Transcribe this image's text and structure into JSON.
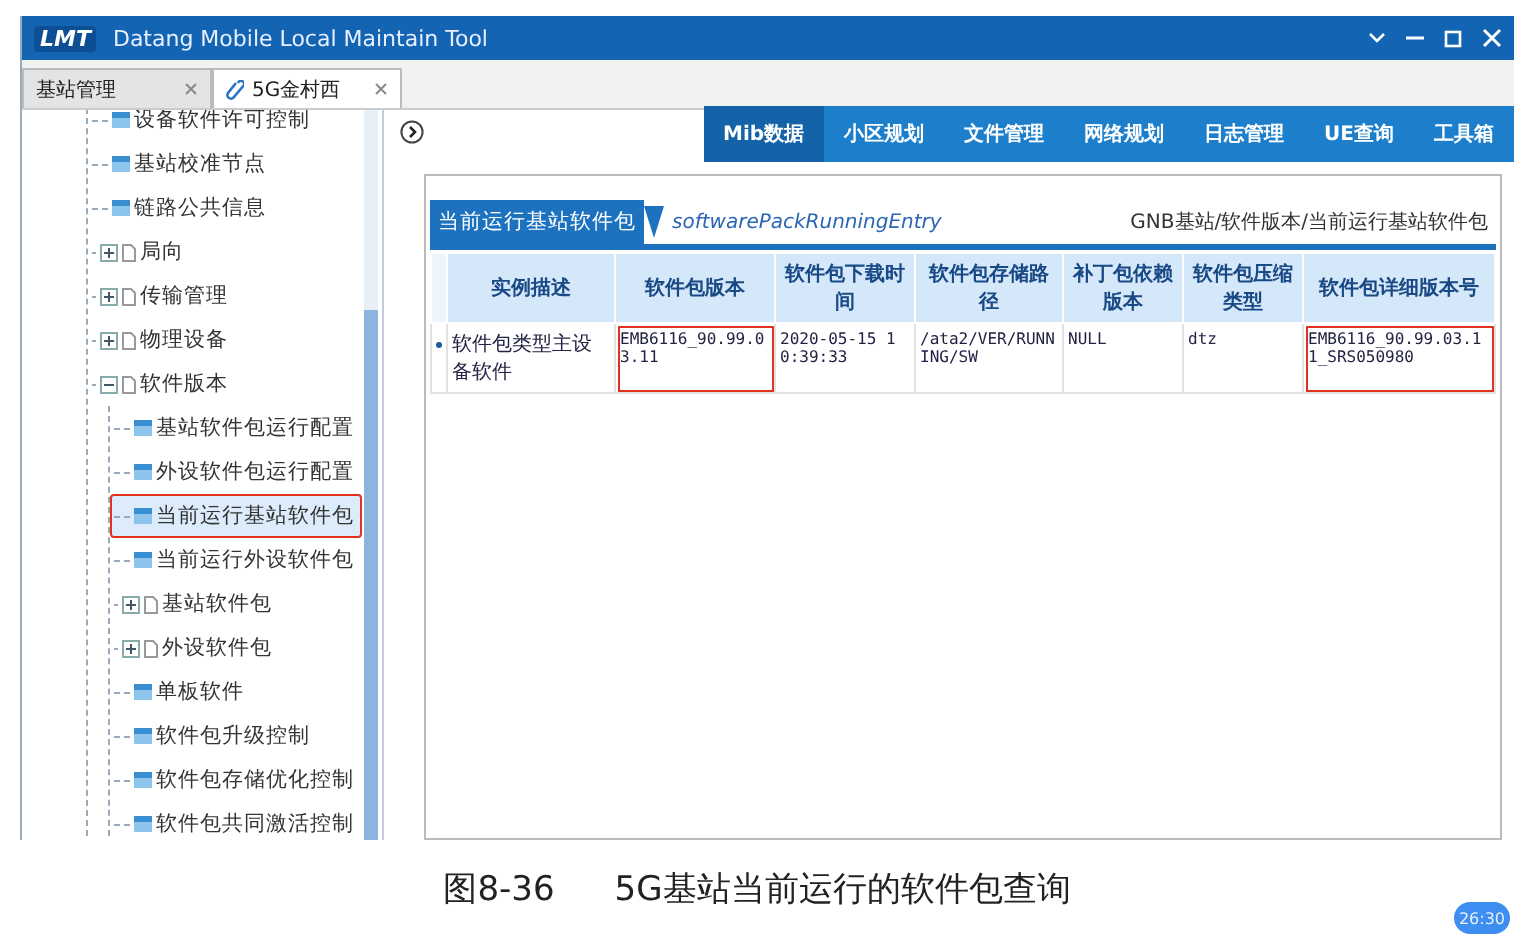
{
  "window": {
    "logo": "LMT",
    "title": "Datang Mobile Local Maintain Tool"
  },
  "doc_tabs": [
    {
      "label": "基站管理",
      "selected": false
    },
    {
      "label": "5G金村西",
      "selected": true
    }
  ],
  "tree": {
    "items": [
      {
        "label": "设备软件许可控制",
        "kind": "leaf",
        "selected": false,
        "highlighted": false
      },
      {
        "label": "基站校准节点",
        "kind": "leaf",
        "selected": false,
        "highlighted": false
      },
      {
        "label": "链路公共信息",
        "kind": "leaf",
        "selected": false,
        "highlighted": false
      },
      {
        "label": "局向",
        "kind": "folder",
        "expanded": false,
        "selected": false,
        "highlighted": false
      },
      {
        "label": "传输管理",
        "kind": "folder",
        "expanded": false,
        "selected": false,
        "highlighted": false
      },
      {
        "label": "物理设备",
        "kind": "folder",
        "expanded": false,
        "selected": false,
        "highlighted": false
      },
      {
        "label": "软件版本",
        "kind": "folder",
        "expanded": true,
        "selected": false,
        "highlighted": false,
        "children": [
          {
            "label": "基站软件包运行配置",
            "kind": "leaf",
            "selected": false,
            "highlighted": false
          },
          {
            "label": "外设软件包运行配置",
            "kind": "leaf",
            "selected": false,
            "highlighted": false
          },
          {
            "label": "当前运行基站软件包",
            "kind": "leaf",
            "selected": true,
            "highlighted": true
          },
          {
            "label": "当前运行外设软件包",
            "kind": "leaf",
            "selected": false,
            "highlighted": false
          },
          {
            "label": "基站软件包",
            "kind": "folder",
            "expanded": false,
            "selected": false,
            "highlighted": false
          },
          {
            "label": "外设软件包",
            "kind": "folder",
            "expanded": false,
            "selected": false,
            "highlighted": false
          },
          {
            "label": "单板软件",
            "kind": "leaf",
            "selected": false,
            "highlighted": false
          },
          {
            "label": "软件包升级控制",
            "kind": "leaf",
            "selected": false,
            "highlighted": false
          },
          {
            "label": "软件包存储优化控制",
            "kind": "leaf",
            "selected": false,
            "highlighted": false
          },
          {
            "label": "软件包共同激活控制",
            "kind": "leaf",
            "selected": false,
            "highlighted": false
          }
        ]
      }
    ]
  },
  "nav_tabs": [
    {
      "label": "Mib数据",
      "selected": true
    },
    {
      "label": "小区规划",
      "selected": false
    },
    {
      "label": "文件管理",
      "selected": false
    },
    {
      "label": "网络规划",
      "selected": false
    },
    {
      "label": "日志管理",
      "selected": false
    },
    {
      "label": "UE查询",
      "selected": false
    },
    {
      "label": "工具箱",
      "selected": false
    }
  ],
  "panel": {
    "title": "当前运行基站软件包",
    "entry": "softwarePackRunningEntry",
    "breadcrumb": "GNB基站/软件版本/当前运行基站软件包",
    "table": {
      "columns": [
        "实例描述",
        "软件包版本",
        "软件包下载时间",
        "软件包存储路径",
        "补丁包依赖版本",
        "软件包压缩类型",
        "软件包详细版本号"
      ],
      "rows": [
        {
          "cells": [
            {
              "text": "软件包类型主设备软件",
              "highlighted": false
            },
            {
              "text": "EMB6116_90.99.03.11",
              "highlighted": true
            },
            {
              "text": "2020-05-15 10:39:33",
              "highlighted": false
            },
            {
              "text": "/ata2/VER/RUNNING/SW",
              "highlighted": false
            },
            {
              "text": "NULL",
              "highlighted": false
            },
            {
              "text": "dtz",
              "highlighted": false
            },
            {
              "text": "EMB6116_90.99.03.11_SRS050980",
              "highlighted": true
            }
          ]
        }
      ]
    }
  },
  "caption": {
    "figure": "图8-36",
    "text": "5G基站当前运行的软件包查询"
  },
  "timestamp": "26:30"
}
